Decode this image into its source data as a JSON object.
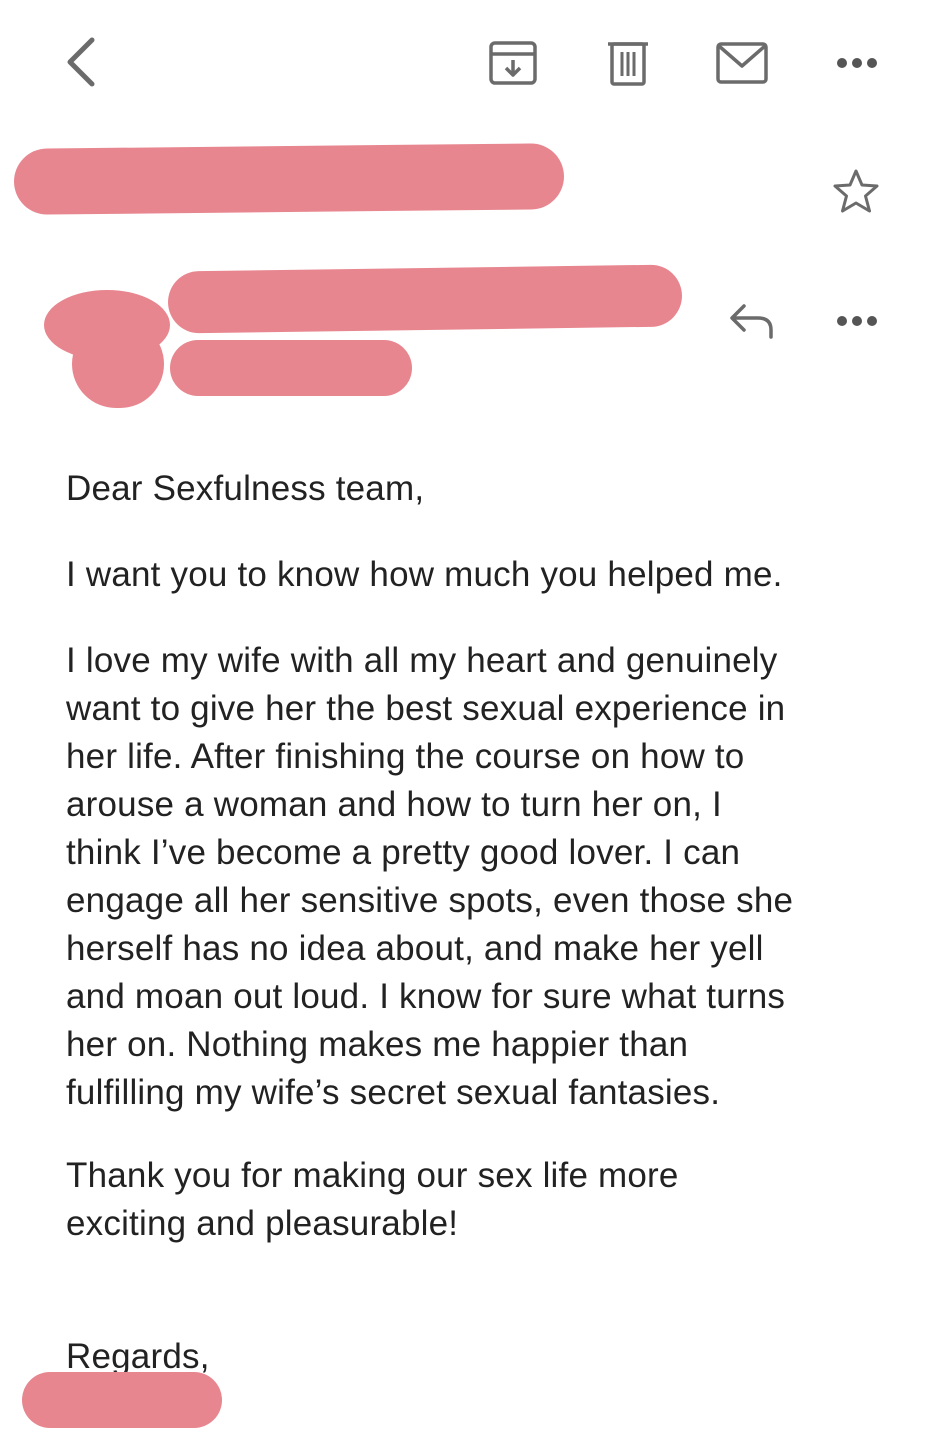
{
  "toolbar": {
    "back_icon": "chevron-left-icon",
    "archive_icon": "archive-icon",
    "delete_icon": "trash-icon",
    "mark_unread_icon": "envelope-icon",
    "more_icon": "more-horizontal-icon"
  },
  "subject": {
    "star_icon": "star-outline-icon"
  },
  "sender": {
    "reply_icon": "reply-icon",
    "more_icon": "more-horizontal-icon"
  },
  "message": {
    "greeting": "Dear Sexfulness team,",
    "paragraphs": [
      "I want you to know how much you helped me.",
      "I love my wife with all my heart and genuinely\nwant to give her the best sexual experience in\nher life. After finishing the course on how to\narouse a woman and how to turn her on, I\nthink I’ve become a pretty good lover. I can\nengage all her sensitive spots, even those she\nherself has no idea about, and make her yell\nand moan out loud. I know for sure what turns\nher on. Nothing makes me happier than\nfulfilling my wife’s secret sexual fantasies.",
      "Thank you for making our sex life more\nexciting and pleasurable!"
    ],
    "signoff": "Regards,"
  },
  "colors": {
    "redaction": "#e8868f",
    "icon_gray": "#6b6b6b",
    "text": "#222222"
  }
}
